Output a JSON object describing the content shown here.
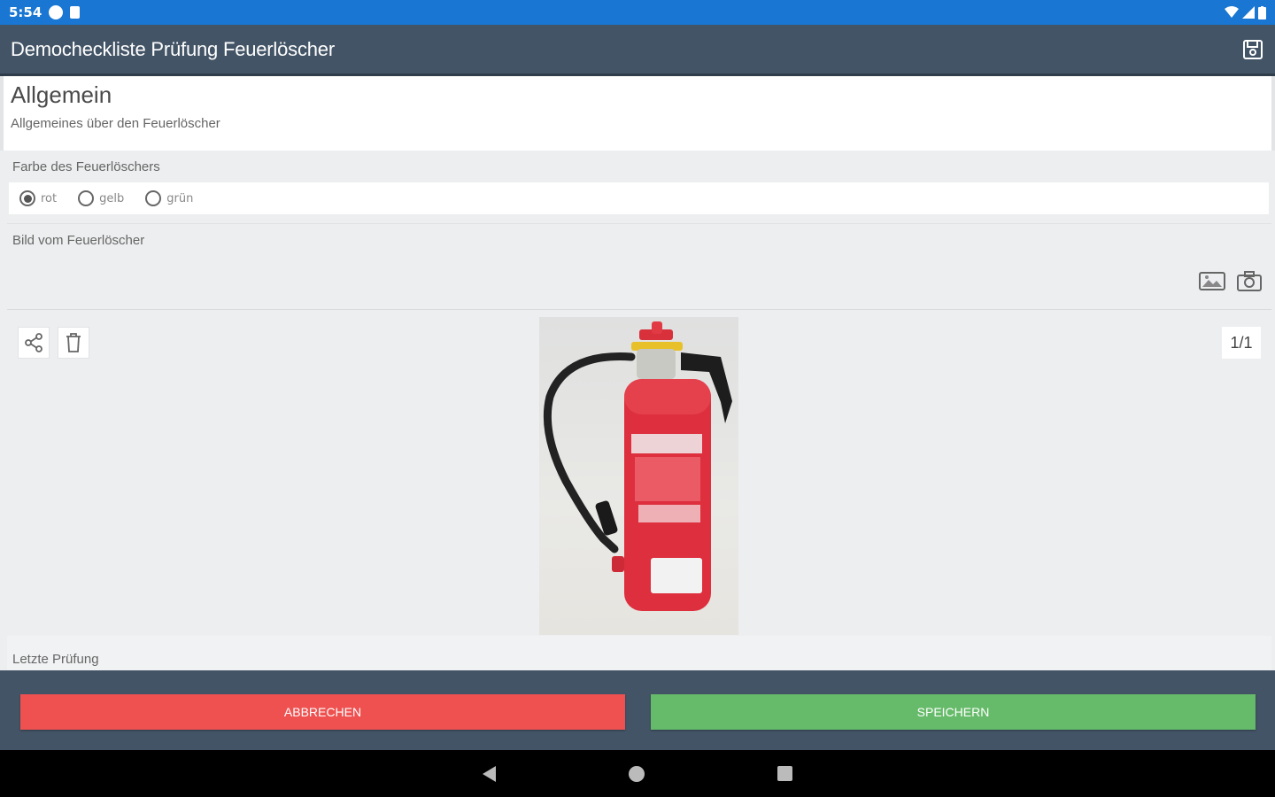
{
  "status_bar": {
    "time": "5:54"
  },
  "app_bar": {
    "title": "Democheckliste Prüfung Feuerlöscher",
    "save_icon": "save-icon"
  },
  "section": {
    "title": "Allgemein",
    "subtitle": "Allgemeines über den Feuerlöscher"
  },
  "color_field": {
    "label": "Farbe des Feuerlöschers",
    "options": [
      {
        "label": "rot",
        "selected": true
      },
      {
        "label": "gelb",
        "selected": false
      },
      {
        "label": "grün",
        "selected": false
      }
    ]
  },
  "image_field": {
    "label": "Bild vom Feuerlöscher",
    "counter": "1/1",
    "icons": {
      "gallery": "gallery-icon",
      "camera": "camera-icon",
      "share": "share-icon",
      "delete": "trash-icon"
    }
  },
  "last_check": {
    "label": "Letzte Prüfung"
  },
  "buttons": {
    "cancel": "ABBRECHEN",
    "save": "SPEICHERN"
  },
  "colors": {
    "status_bar": "#1976d2",
    "app_bar": "#435466",
    "cancel": "#ee5150",
    "save": "#66bb6a"
  }
}
